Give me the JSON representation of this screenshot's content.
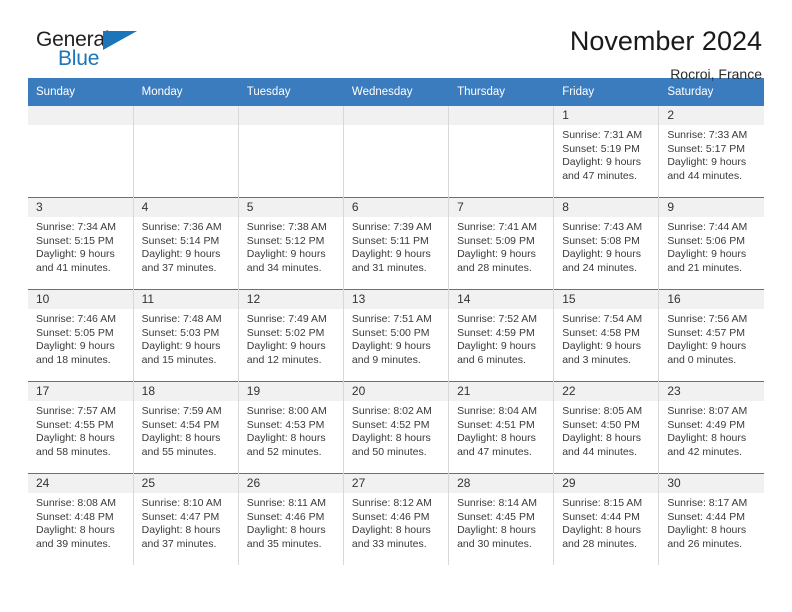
{
  "brand": {
    "name_part1": "General",
    "name_part2": "Blue",
    "flag_icon": "triangle-flag-icon"
  },
  "header": {
    "month_title": "November 2024",
    "location": "Rocroi, France"
  },
  "theme": {
    "header_blue": "#3a7cbe",
    "brand_blue": "#1b75bb",
    "daynum_band": "#f1f1f1",
    "row_divider": "#6f6f6f",
    "col_divider": "#d8d8d8",
    "text": "#3a3a3a"
  },
  "weekday_headers": [
    "Sunday",
    "Monday",
    "Tuesday",
    "Wednesday",
    "Thursday",
    "Friday",
    "Saturday"
  ],
  "weeks": [
    [
      {
        "day": "",
        "empty": true
      },
      {
        "day": "",
        "empty": true
      },
      {
        "day": "",
        "empty": true
      },
      {
        "day": "",
        "empty": true
      },
      {
        "day": "",
        "empty": true
      },
      {
        "day": "1",
        "sunrise": "Sunrise: 7:31 AM",
        "sunset": "Sunset: 5:19 PM",
        "daylight_line1": "Daylight: 9 hours",
        "daylight_line2": "and 47 minutes."
      },
      {
        "day": "2",
        "sunrise": "Sunrise: 7:33 AM",
        "sunset": "Sunset: 5:17 PM",
        "daylight_line1": "Daylight: 9 hours",
        "daylight_line2": "and 44 minutes."
      }
    ],
    [
      {
        "day": "3",
        "sunrise": "Sunrise: 7:34 AM",
        "sunset": "Sunset: 5:15 PM",
        "daylight_line1": "Daylight: 9 hours",
        "daylight_line2": "and 41 minutes."
      },
      {
        "day": "4",
        "sunrise": "Sunrise: 7:36 AM",
        "sunset": "Sunset: 5:14 PM",
        "daylight_line1": "Daylight: 9 hours",
        "daylight_line2": "and 37 minutes."
      },
      {
        "day": "5",
        "sunrise": "Sunrise: 7:38 AM",
        "sunset": "Sunset: 5:12 PM",
        "daylight_line1": "Daylight: 9 hours",
        "daylight_line2": "and 34 minutes."
      },
      {
        "day": "6",
        "sunrise": "Sunrise: 7:39 AM",
        "sunset": "Sunset: 5:11 PM",
        "daylight_line1": "Daylight: 9 hours",
        "daylight_line2": "and 31 minutes."
      },
      {
        "day": "7",
        "sunrise": "Sunrise: 7:41 AM",
        "sunset": "Sunset: 5:09 PM",
        "daylight_line1": "Daylight: 9 hours",
        "daylight_line2": "and 28 minutes."
      },
      {
        "day": "8",
        "sunrise": "Sunrise: 7:43 AM",
        "sunset": "Sunset: 5:08 PM",
        "daylight_line1": "Daylight: 9 hours",
        "daylight_line2": "and 24 minutes."
      },
      {
        "day": "9",
        "sunrise": "Sunrise: 7:44 AM",
        "sunset": "Sunset: 5:06 PM",
        "daylight_line1": "Daylight: 9 hours",
        "daylight_line2": "and 21 minutes."
      }
    ],
    [
      {
        "day": "10",
        "sunrise": "Sunrise: 7:46 AM",
        "sunset": "Sunset: 5:05 PM",
        "daylight_line1": "Daylight: 9 hours",
        "daylight_line2": "and 18 minutes."
      },
      {
        "day": "11",
        "sunrise": "Sunrise: 7:48 AM",
        "sunset": "Sunset: 5:03 PM",
        "daylight_line1": "Daylight: 9 hours",
        "daylight_line2": "and 15 minutes."
      },
      {
        "day": "12",
        "sunrise": "Sunrise: 7:49 AM",
        "sunset": "Sunset: 5:02 PM",
        "daylight_line1": "Daylight: 9 hours",
        "daylight_line2": "and 12 minutes."
      },
      {
        "day": "13",
        "sunrise": "Sunrise: 7:51 AM",
        "sunset": "Sunset: 5:00 PM",
        "daylight_line1": "Daylight: 9 hours",
        "daylight_line2": "and 9 minutes."
      },
      {
        "day": "14",
        "sunrise": "Sunrise: 7:52 AM",
        "sunset": "Sunset: 4:59 PM",
        "daylight_line1": "Daylight: 9 hours",
        "daylight_line2": "and 6 minutes."
      },
      {
        "day": "15",
        "sunrise": "Sunrise: 7:54 AM",
        "sunset": "Sunset: 4:58 PM",
        "daylight_line1": "Daylight: 9 hours",
        "daylight_line2": "and 3 minutes."
      },
      {
        "day": "16",
        "sunrise": "Sunrise: 7:56 AM",
        "sunset": "Sunset: 4:57 PM",
        "daylight_line1": "Daylight: 9 hours",
        "daylight_line2": "and 0 minutes."
      }
    ],
    [
      {
        "day": "17",
        "sunrise": "Sunrise: 7:57 AM",
        "sunset": "Sunset: 4:55 PM",
        "daylight_line1": "Daylight: 8 hours",
        "daylight_line2": "and 58 minutes."
      },
      {
        "day": "18",
        "sunrise": "Sunrise: 7:59 AM",
        "sunset": "Sunset: 4:54 PM",
        "daylight_line1": "Daylight: 8 hours",
        "daylight_line2": "and 55 minutes."
      },
      {
        "day": "19",
        "sunrise": "Sunrise: 8:00 AM",
        "sunset": "Sunset: 4:53 PM",
        "daylight_line1": "Daylight: 8 hours",
        "daylight_line2": "and 52 minutes."
      },
      {
        "day": "20",
        "sunrise": "Sunrise: 8:02 AM",
        "sunset": "Sunset: 4:52 PM",
        "daylight_line1": "Daylight: 8 hours",
        "daylight_line2": "and 50 minutes."
      },
      {
        "day": "21",
        "sunrise": "Sunrise: 8:04 AM",
        "sunset": "Sunset: 4:51 PM",
        "daylight_line1": "Daylight: 8 hours",
        "daylight_line2": "and 47 minutes."
      },
      {
        "day": "22",
        "sunrise": "Sunrise: 8:05 AM",
        "sunset": "Sunset: 4:50 PM",
        "daylight_line1": "Daylight: 8 hours",
        "daylight_line2": "and 44 minutes."
      },
      {
        "day": "23",
        "sunrise": "Sunrise: 8:07 AM",
        "sunset": "Sunset: 4:49 PM",
        "daylight_line1": "Daylight: 8 hours",
        "daylight_line2": "and 42 minutes."
      }
    ],
    [
      {
        "day": "24",
        "sunrise": "Sunrise: 8:08 AM",
        "sunset": "Sunset: 4:48 PM",
        "daylight_line1": "Daylight: 8 hours",
        "daylight_line2": "and 39 minutes."
      },
      {
        "day": "25",
        "sunrise": "Sunrise: 8:10 AM",
        "sunset": "Sunset: 4:47 PM",
        "daylight_line1": "Daylight: 8 hours",
        "daylight_line2": "and 37 minutes."
      },
      {
        "day": "26",
        "sunrise": "Sunrise: 8:11 AM",
        "sunset": "Sunset: 4:46 PM",
        "daylight_line1": "Daylight: 8 hours",
        "daylight_line2": "and 35 minutes."
      },
      {
        "day": "27",
        "sunrise": "Sunrise: 8:12 AM",
        "sunset": "Sunset: 4:46 PM",
        "daylight_line1": "Daylight: 8 hours",
        "daylight_line2": "and 33 minutes."
      },
      {
        "day": "28",
        "sunrise": "Sunrise: 8:14 AM",
        "sunset": "Sunset: 4:45 PM",
        "daylight_line1": "Daylight: 8 hours",
        "daylight_line2": "and 30 minutes."
      },
      {
        "day": "29",
        "sunrise": "Sunrise: 8:15 AM",
        "sunset": "Sunset: 4:44 PM",
        "daylight_line1": "Daylight: 8 hours",
        "daylight_line2": "and 28 minutes."
      },
      {
        "day": "30",
        "sunrise": "Sunrise: 8:17 AM",
        "sunset": "Sunset: 4:44 PM",
        "daylight_line1": "Daylight: 8 hours",
        "daylight_line2": "and 26 minutes."
      }
    ]
  ]
}
